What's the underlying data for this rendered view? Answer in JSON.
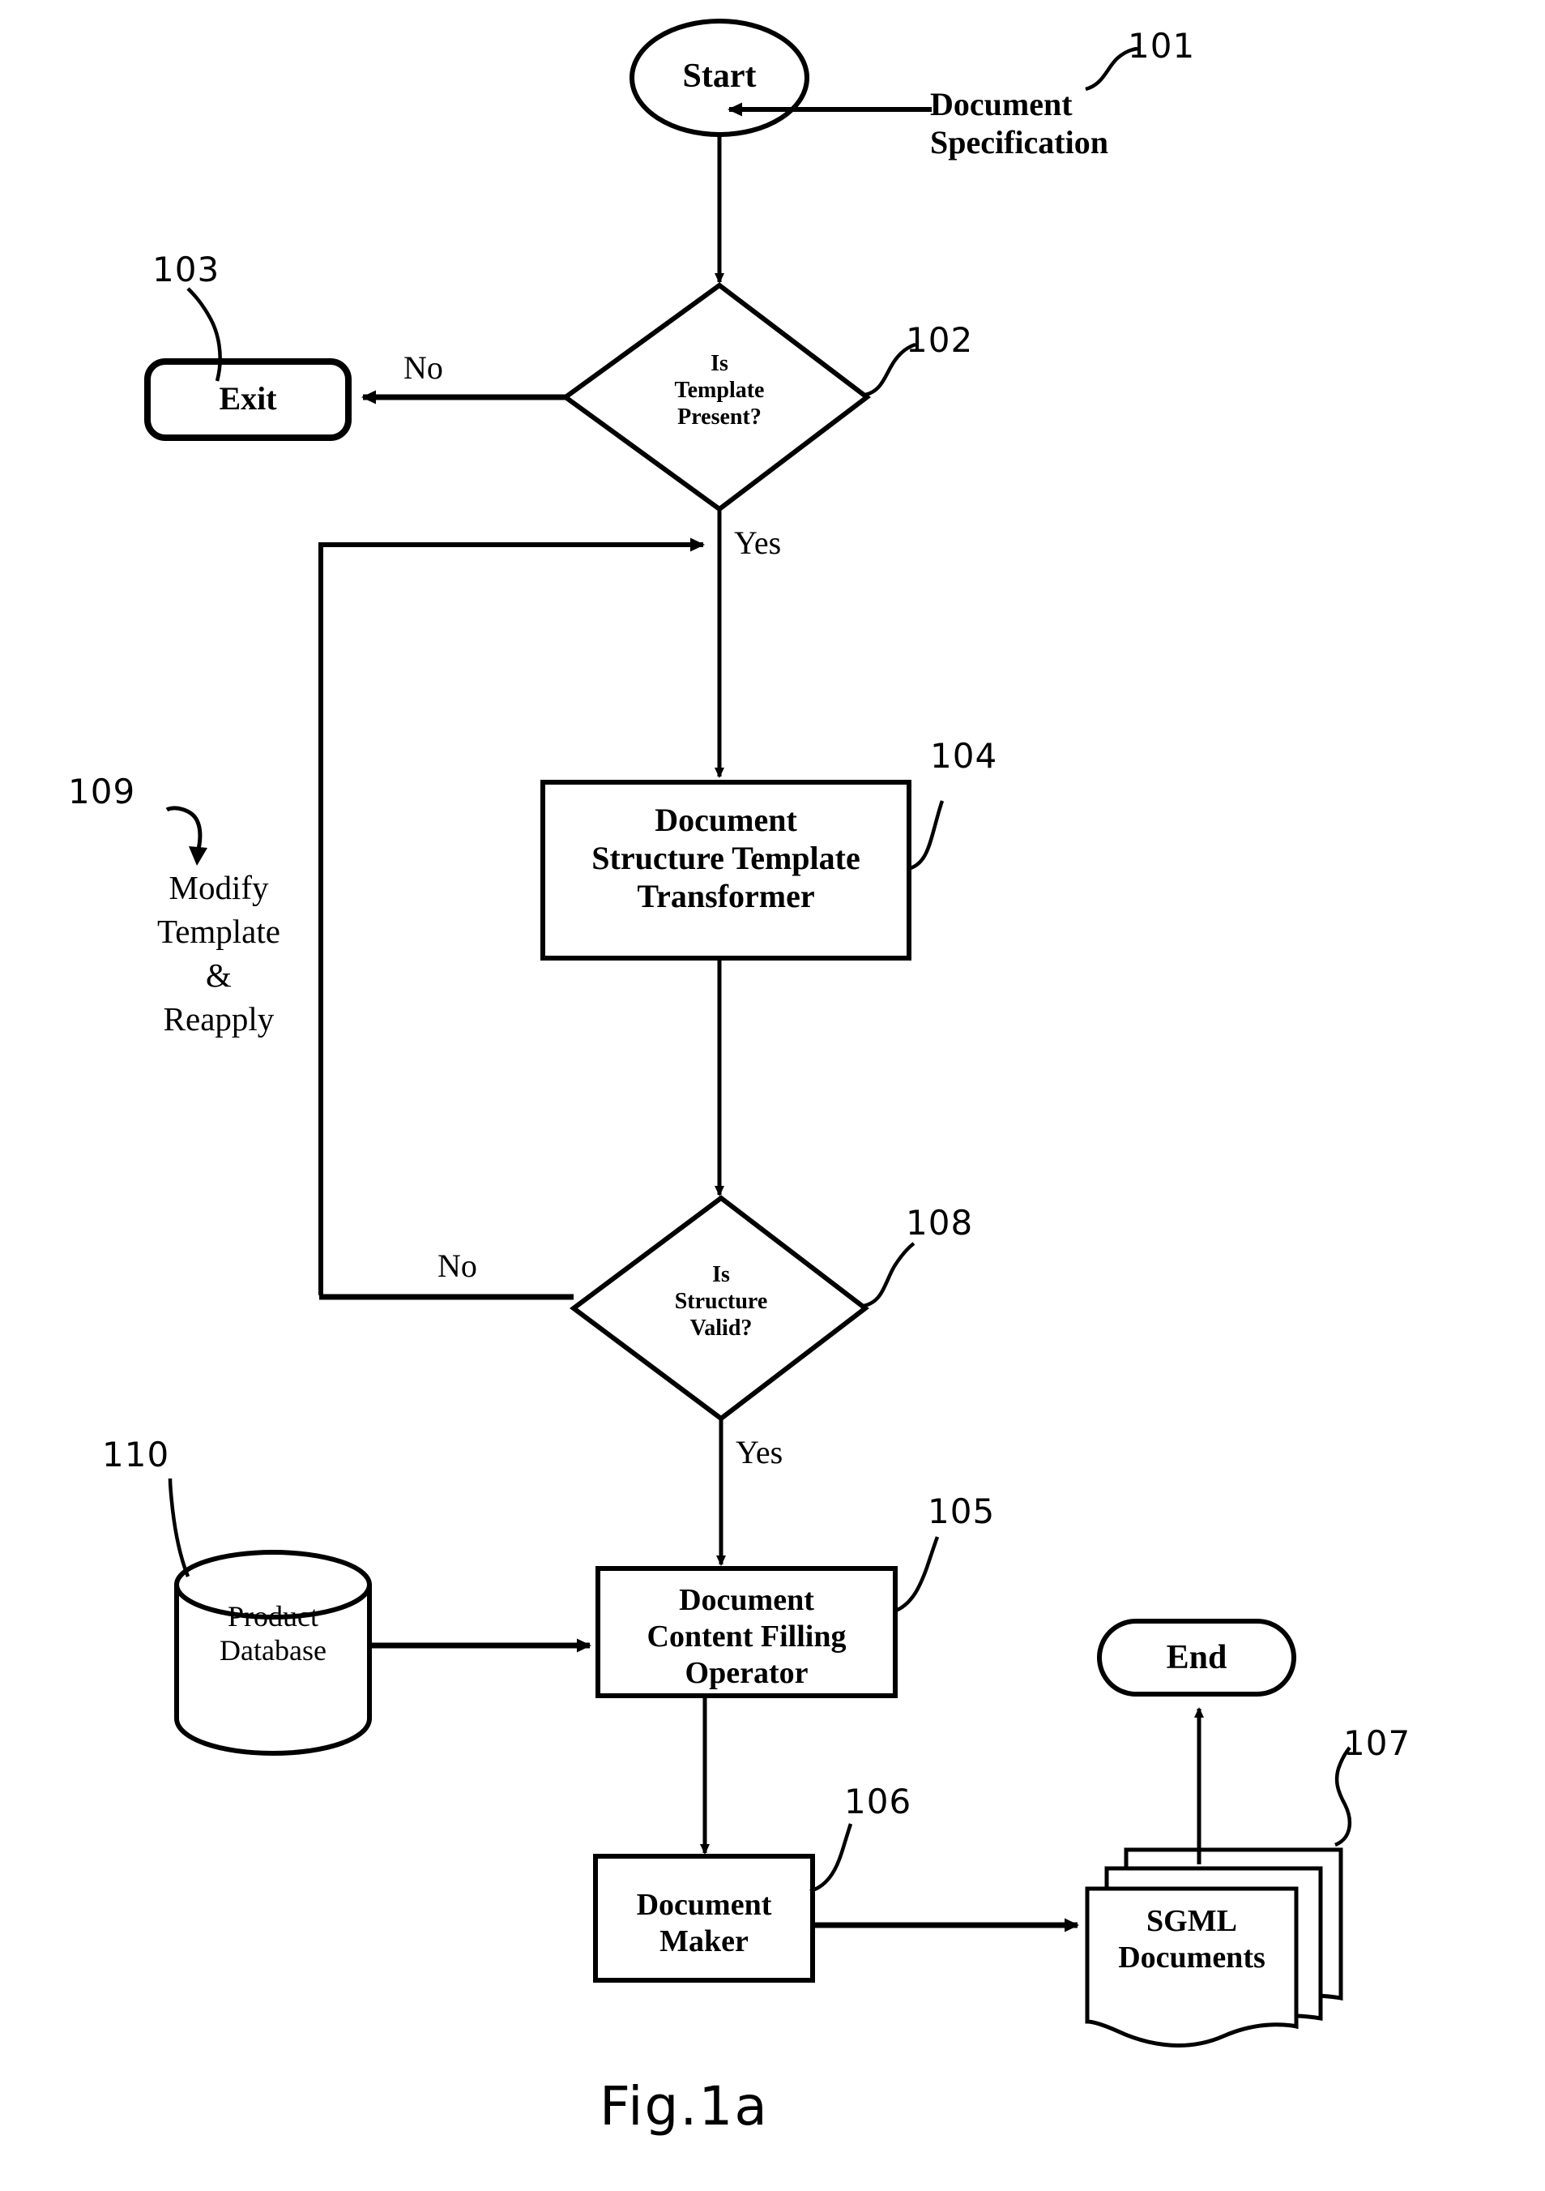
{
  "figure": {
    "caption": "Fig.1a",
    "type": "patent-flowchart"
  },
  "nodes": {
    "start": {
      "label": "Start",
      "shape": "ellipse"
    },
    "decision_template": {
      "label": "Is\nTemplate\nPresent?",
      "shape": "diamond",
      "ref": "102"
    },
    "exit": {
      "label": "Exit",
      "shape": "rounded-rect",
      "ref": "103"
    },
    "transformer": {
      "label": "Document\nStructure Template\nTransformer",
      "shape": "rect",
      "ref": "104"
    },
    "decision_structure": {
      "label": "Is\nStructure\nValid?",
      "shape": "diamond",
      "ref": "108"
    },
    "content_filler": {
      "label": "Document\nContent Filling\nOperator",
      "shape": "rect",
      "ref": "105"
    },
    "product_db": {
      "label": "Product\nDatabase",
      "shape": "cylinder",
      "ref": "110"
    },
    "document_maker": {
      "label": "Document\nMaker",
      "shape": "rect",
      "ref": "106"
    },
    "sgml_documents": {
      "label": "SGML\nDocuments",
      "shape": "document-stack",
      "ref": "107"
    },
    "end": {
      "label": "End",
      "shape": "stadium"
    }
  },
  "annotations": {
    "document_specification": {
      "label": "Document\nSpecification",
      "ref": "101"
    },
    "modify_template": {
      "label": "Modify\nTemplate\n&\nReapply",
      "ref": "109"
    }
  },
  "edge_labels": {
    "template_no": "No",
    "template_yes": "Yes",
    "structure_no": "No",
    "structure_yes": "Yes"
  },
  "colors": {
    "stroke": "#000000",
    "background": "#ffffff"
  }
}
